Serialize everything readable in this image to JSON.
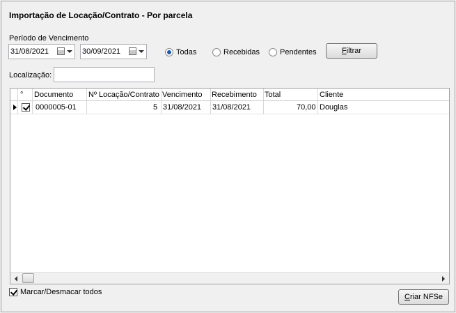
{
  "title": "Importação de Locação/Contrato - Por parcela",
  "period": {
    "label": "Período de Vencimento",
    "start": "31/08/2021",
    "end": "30/09/2021"
  },
  "filters": {
    "options": [
      "Todas",
      "Recebidas",
      "Pendentes"
    ],
    "selected": "Todas",
    "filter_button_prefix": "F",
    "filter_button_rest": "iltrar"
  },
  "location": {
    "label": "Localização:",
    "value": ""
  },
  "grid": {
    "columns": [
      "°",
      "Documento",
      "Nº Locação/Contrato",
      "Vencimento",
      "Recebimento",
      "Total",
      "Cliente"
    ],
    "rows": [
      {
        "checked": true,
        "documento": "0000005-01",
        "locacao": "5",
        "vencimento": "31/08/2021",
        "recebimento": "31/08/2021",
        "total": "70,00",
        "cliente": "Douglas"
      }
    ]
  },
  "footer": {
    "mark_all_label": "Marcar/Desmacar todos",
    "mark_all_checked": true,
    "create_button_prefix": "C",
    "create_button_rest": "riar NFSe"
  }
}
